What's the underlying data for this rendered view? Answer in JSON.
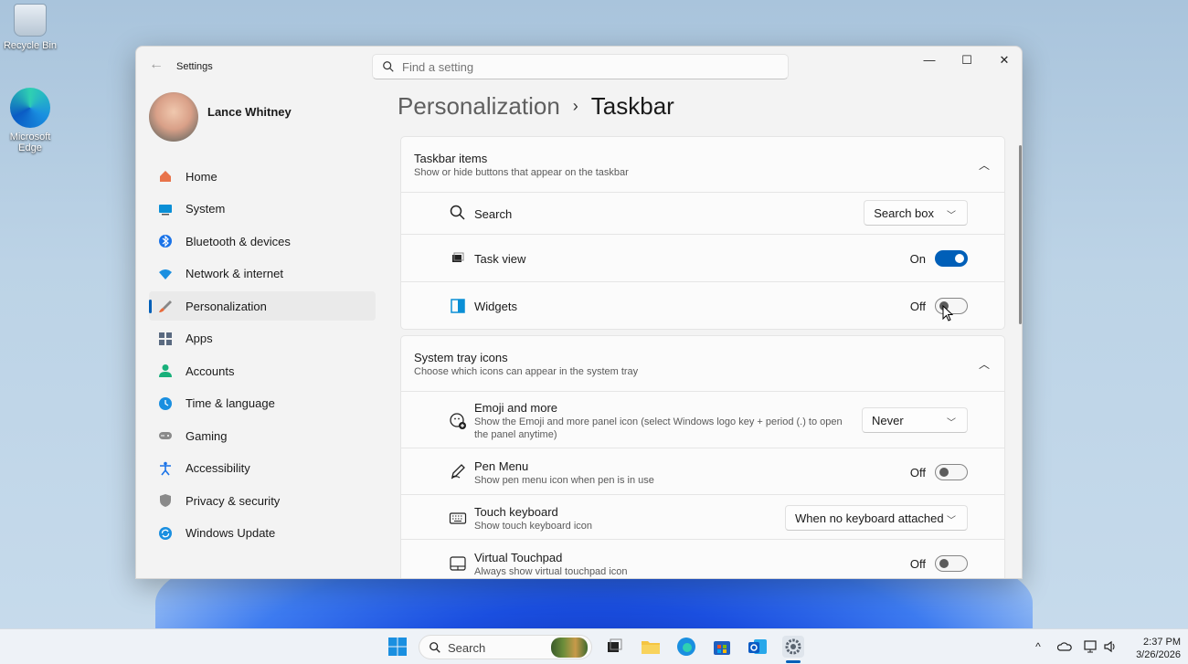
{
  "desktop": {
    "icons": [
      {
        "label": "Recycle Bin"
      },
      {
        "label": "Microsoft Edge"
      }
    ]
  },
  "window": {
    "app_title": "Settings",
    "search_placeholder": "Find a setting",
    "controls": {
      "minimize": "—",
      "maximize": "☐",
      "close": "✕"
    }
  },
  "profile": {
    "name": "Lance Whitney"
  },
  "nav": {
    "items": [
      {
        "label": "Home",
        "icon": "home-icon",
        "color": "#e8734a"
      },
      {
        "label": "System",
        "icon": "system-icon",
        "color": "#0a8fd6"
      },
      {
        "label": "Bluetooth & devices",
        "icon": "bluetooth-icon",
        "color": "#1a73e8"
      },
      {
        "label": "Network & internet",
        "icon": "wifi-icon",
        "color": "#1a8fe0"
      },
      {
        "label": "Personalization",
        "icon": "brush-icon",
        "color": "#e86a3a",
        "active": true
      },
      {
        "label": "Apps",
        "icon": "apps-icon",
        "color": "#5a6a80"
      },
      {
        "label": "Accounts",
        "icon": "accounts-icon",
        "color": "#18b07a"
      },
      {
        "label": "Time & language",
        "icon": "globe-clock-icon",
        "color": "#1a8fe0"
      },
      {
        "label": "Gaming",
        "icon": "gamepad-icon",
        "color": "#8a8a8a"
      },
      {
        "label": "Accessibility",
        "icon": "accessibility-icon",
        "color": "#1a73e8"
      },
      {
        "label": "Privacy & security",
        "icon": "shield-icon",
        "color": "#8a8a8a"
      },
      {
        "label": "Windows Update",
        "icon": "update-icon",
        "color": "#1a8fe0"
      }
    ]
  },
  "breadcrumb": {
    "parent": "Personalization",
    "separator": "›",
    "current": "Taskbar"
  },
  "taskbar_items": {
    "title": "Taskbar items",
    "subtitle": "Show or hide buttons that appear on the taskbar",
    "rows": [
      {
        "label": "Search",
        "icon": "search-icon",
        "control": "dropdown",
        "value": "Search box"
      },
      {
        "label": "Task view",
        "icon": "task-view-icon",
        "control": "toggle",
        "state_label": "On",
        "on": true
      },
      {
        "label": "Widgets",
        "icon": "widgets-icon",
        "control": "toggle",
        "state_label": "Off",
        "on": false
      }
    ]
  },
  "tray_icons": {
    "title": "System tray icons",
    "subtitle": "Choose which icons can appear in the system tray",
    "rows": [
      {
        "label": "Emoji and more",
        "desc": "Show the Emoji and more panel icon (select Windows logo key + period (.) to open the panel anytime)",
        "icon": "emoji-icon",
        "control": "dropdown",
        "value": "Never"
      },
      {
        "label": "Pen Menu",
        "desc": "Show pen menu icon when pen is in use",
        "icon": "pen-icon",
        "control": "toggle",
        "state_label": "Off",
        "on": false
      },
      {
        "label": "Touch keyboard",
        "desc": "Show touch keyboard icon",
        "icon": "keyboard-icon",
        "control": "dropdown",
        "value": "When no keyboard attached"
      },
      {
        "label": "Virtual Touchpad",
        "desc": "Always show virtual touchpad icon",
        "icon": "touchpad-icon",
        "control": "toggle",
        "state_label": "Off",
        "on": false
      }
    ]
  },
  "taskbar": {
    "search_label": "Search",
    "tray": {
      "chevron": "^"
    },
    "clock": {
      "time": "2:37 PM",
      "date": "3/26/2026"
    }
  },
  "colors": {
    "accent": "#005fb8"
  }
}
